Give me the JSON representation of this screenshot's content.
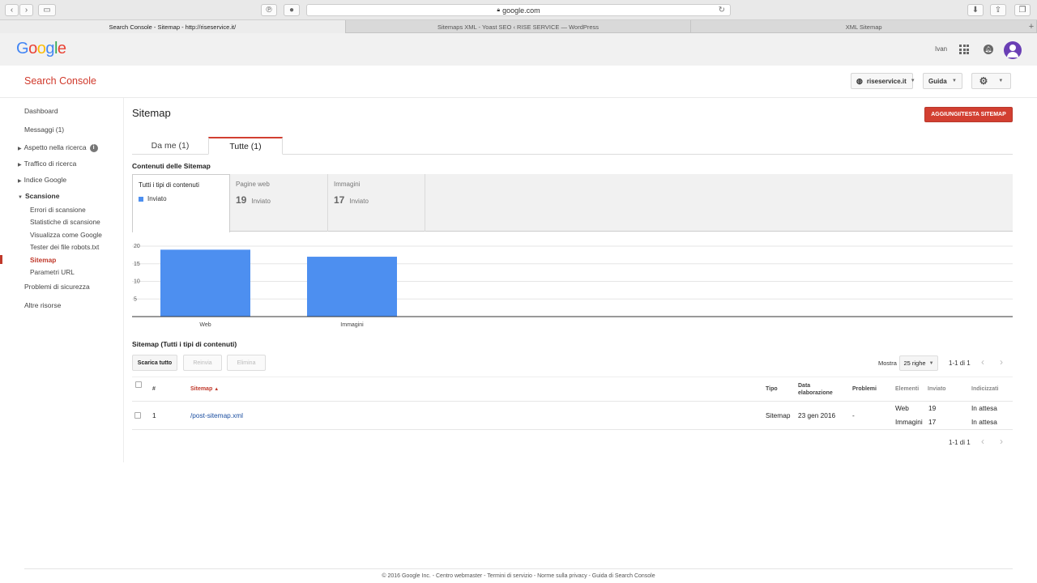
{
  "browser": {
    "url": "google.com",
    "tabs": [
      {
        "label": "Search Console - Sitemap - http://riseservice.it/"
      },
      {
        "label": "Sitemaps XML - Yoast SEO ‹ RISE SERVICE — WordPress"
      },
      {
        "label": "XML Sitemap"
      }
    ]
  },
  "google": {
    "logo": [
      "G",
      "o",
      "o",
      "g",
      "l",
      "e"
    ],
    "user_name": "Ivan"
  },
  "console": {
    "title": "Search Console",
    "property": "riseservice.it",
    "help_label": "Guida"
  },
  "sidebar": {
    "items": [
      {
        "label": "Dashboard"
      },
      {
        "label": "Messaggi (1)"
      },
      {
        "label": "Aspetto nella ricerca"
      },
      {
        "label": "Traffico di ricerca"
      },
      {
        "label": "Indice Google"
      },
      {
        "label": "Scansione"
      },
      {
        "label": "Errori di scansione"
      },
      {
        "label": "Statistiche di scansione"
      },
      {
        "label": "Visualizza come Google"
      },
      {
        "label": "Tester dei file robots.txt"
      },
      {
        "label": "Sitemap"
      },
      {
        "label": "Parametri URL"
      },
      {
        "label": "Problemi di sicurezza"
      },
      {
        "label": "Altre risorse"
      }
    ],
    "active": "Sitemap"
  },
  "main": {
    "title": "Sitemap",
    "add_button": "AGGIUNGI/TESTA SITEMAP",
    "tabs": [
      {
        "label": "Da me (1)"
      },
      {
        "label": "Tutte (1)"
      }
    ],
    "contents_title": "Contenuti delle Sitemap",
    "cards": [
      {
        "title": "Tutti i tipi di contenuti",
        "legend": "Inviato",
        "legend_color": "#4d8ff0"
      },
      {
        "title": "Pagine web",
        "value": "19",
        "unit": "Inviato"
      },
      {
        "title": "Immagini",
        "value": "17",
        "unit": "Inviato"
      }
    ]
  },
  "chart_data": {
    "type": "bar",
    "categories": [
      "Web",
      "Immagini"
    ],
    "values": [
      19,
      17
    ],
    "yticks": [
      5,
      10,
      15,
      20
    ],
    "ylim": [
      0,
      20
    ],
    "color": "#4d8ff0",
    "grid": true
  },
  "table": {
    "title": "Sitemap (Tutti i tipi di contenuti)",
    "actions": {
      "download": "Scarica tutto",
      "resubmit": "Reinvia",
      "delete": "Elimina"
    },
    "show_label": "Mostra",
    "rows_per_page": "25 righe",
    "pagination": "1-1 di 1",
    "headers": {
      "num": "#",
      "sitemap": "Sitemap",
      "type": "Tipo",
      "date": "Data elaborazione",
      "problems": "Problemi",
      "elements": "Elementi",
      "sent": "Inviato",
      "indexed": "Indicizzati"
    },
    "rows": [
      {
        "num": "1",
        "path": "/post-sitemap.xml",
        "type": "Sitemap",
        "date": "23 gen 2016",
        "problems": "-",
        "elements": [
          {
            "name": "Web",
            "sent": "19",
            "indexed": "In attesa"
          },
          {
            "name": "Immagini",
            "sent": "17",
            "indexed": "In attesa"
          }
        ]
      }
    ]
  },
  "footer": "© 2016 Google Inc. - Centro webmaster - Termini di servizio - Norme sulla privacy - Guida di Search Console",
  "colors": {
    "accent": "#d23f31",
    "bar": "#4d8ff0",
    "link": "#1a4ea0"
  }
}
